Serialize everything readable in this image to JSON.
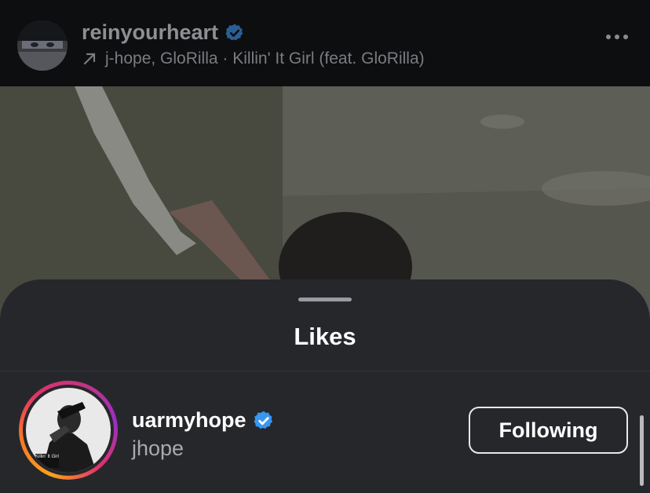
{
  "post": {
    "username": "reinyourheart",
    "music": "j-hope, GloRilla · Killin' It Girl (feat. GloRilla)",
    "verified_icon": "verified-badge-icon",
    "more_icon": "more-horizontal-icon"
  },
  "sheet": {
    "title": "Likes"
  },
  "likes": [
    {
      "username": "uarmyhope",
      "full_name": "jhope",
      "button": "Following",
      "avatar_caption": "Killin' It Girl"
    }
  ],
  "colors": {
    "verified": "#3897f0",
    "sheet_bg": "#26272b",
    "ring_start": "#f9a21a",
    "ring_end": "#c13584"
  }
}
